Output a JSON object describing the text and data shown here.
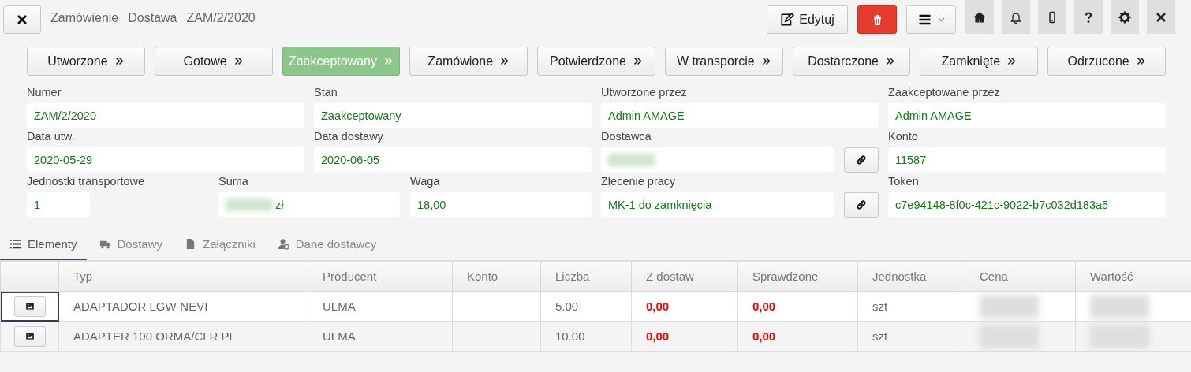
{
  "header": {
    "breadcrumb": [
      "Zamówienie",
      "Dostawa",
      "ZAM/2/2020"
    ],
    "edit_label": "Edytuj"
  },
  "statuses": [
    {
      "label": "Utworzone",
      "selected": false
    },
    {
      "label": "Gotowe",
      "selected": false
    },
    {
      "label": "Zaakceptowany",
      "selected": true
    },
    {
      "label": "Zamówione",
      "selected": false
    },
    {
      "label": "Potwierdzone",
      "selected": false
    },
    {
      "label": "W transporcie",
      "selected": false
    },
    {
      "label": "Dostarczone",
      "selected": false
    },
    {
      "label": "Zamknięte",
      "selected": false
    },
    {
      "label": "Odrzucone",
      "selected": false
    }
  ],
  "form": {
    "fields": [
      {
        "label": "Numer",
        "value": "ZAM/2/2020"
      },
      {
        "label": "Stan",
        "value": "Zaakceptowany"
      },
      {
        "label": "Utworzone przez",
        "value": "Admin AMAGE"
      },
      {
        "label": "Zaakceptowane przez",
        "value": "Admin AMAGE"
      },
      {
        "label": "Data utw.",
        "value": "2020-05-29"
      },
      {
        "label": "Data dostawy",
        "value": "2020-06-05"
      },
      {
        "label": "Dostawca",
        "redacted": true,
        "link": true
      },
      {
        "label": "Konto",
        "value": "11587"
      },
      {
        "label": "Jednostki transportowe",
        "value": "1"
      },
      {
        "label": "Suma",
        "value": "zł",
        "redacted": true
      },
      {
        "label": "Waga",
        "value": "18,00"
      },
      {
        "label": "Zlecenie pracy",
        "value": "MK-1 do zamknięcia",
        "link": true
      },
      {
        "label": "Token",
        "value": "c7e94148-8f0c-421c-9022-b7c032d183a5"
      }
    ]
  },
  "tabs": [
    {
      "label": "Elementy",
      "selected": true
    },
    {
      "label": "Dostawy",
      "selected": false
    },
    {
      "label": "Załączniki",
      "selected": false
    },
    {
      "label": "Dane dostawcy",
      "selected": false
    }
  ],
  "table": {
    "columns": [
      {
        "label": "Typ",
        "kind": "text"
      },
      {
        "label": "Producent",
        "kind": "text"
      },
      {
        "label": "Konto",
        "kind": "blank"
      },
      {
        "label": "Liczba",
        "kind": "text"
      },
      {
        "label": "Z dostaw",
        "kind": "alert"
      },
      {
        "label": "Sprawdzone",
        "kind": "alert"
      },
      {
        "label": "Jednostka",
        "kind": "text"
      },
      {
        "label": "Cena",
        "kind": "redacted"
      },
      {
        "label": "Wartość",
        "kind": "redacted"
      }
    ],
    "rows": [
      {
        "selected": true,
        "cells": [
          "ADAPTADOR LGW-NEVI",
          "ULMA",
          "",
          "5.00",
          "0,00",
          "0,00",
          "szt"
        ]
      },
      {
        "selected": false,
        "cells": [
          "ADAPTER 100 ORMA/CLR PL",
          "ULMA",
          "",
          "10.00",
          "0,00",
          "0,00",
          "szt"
        ]
      }
    ]
  }
}
